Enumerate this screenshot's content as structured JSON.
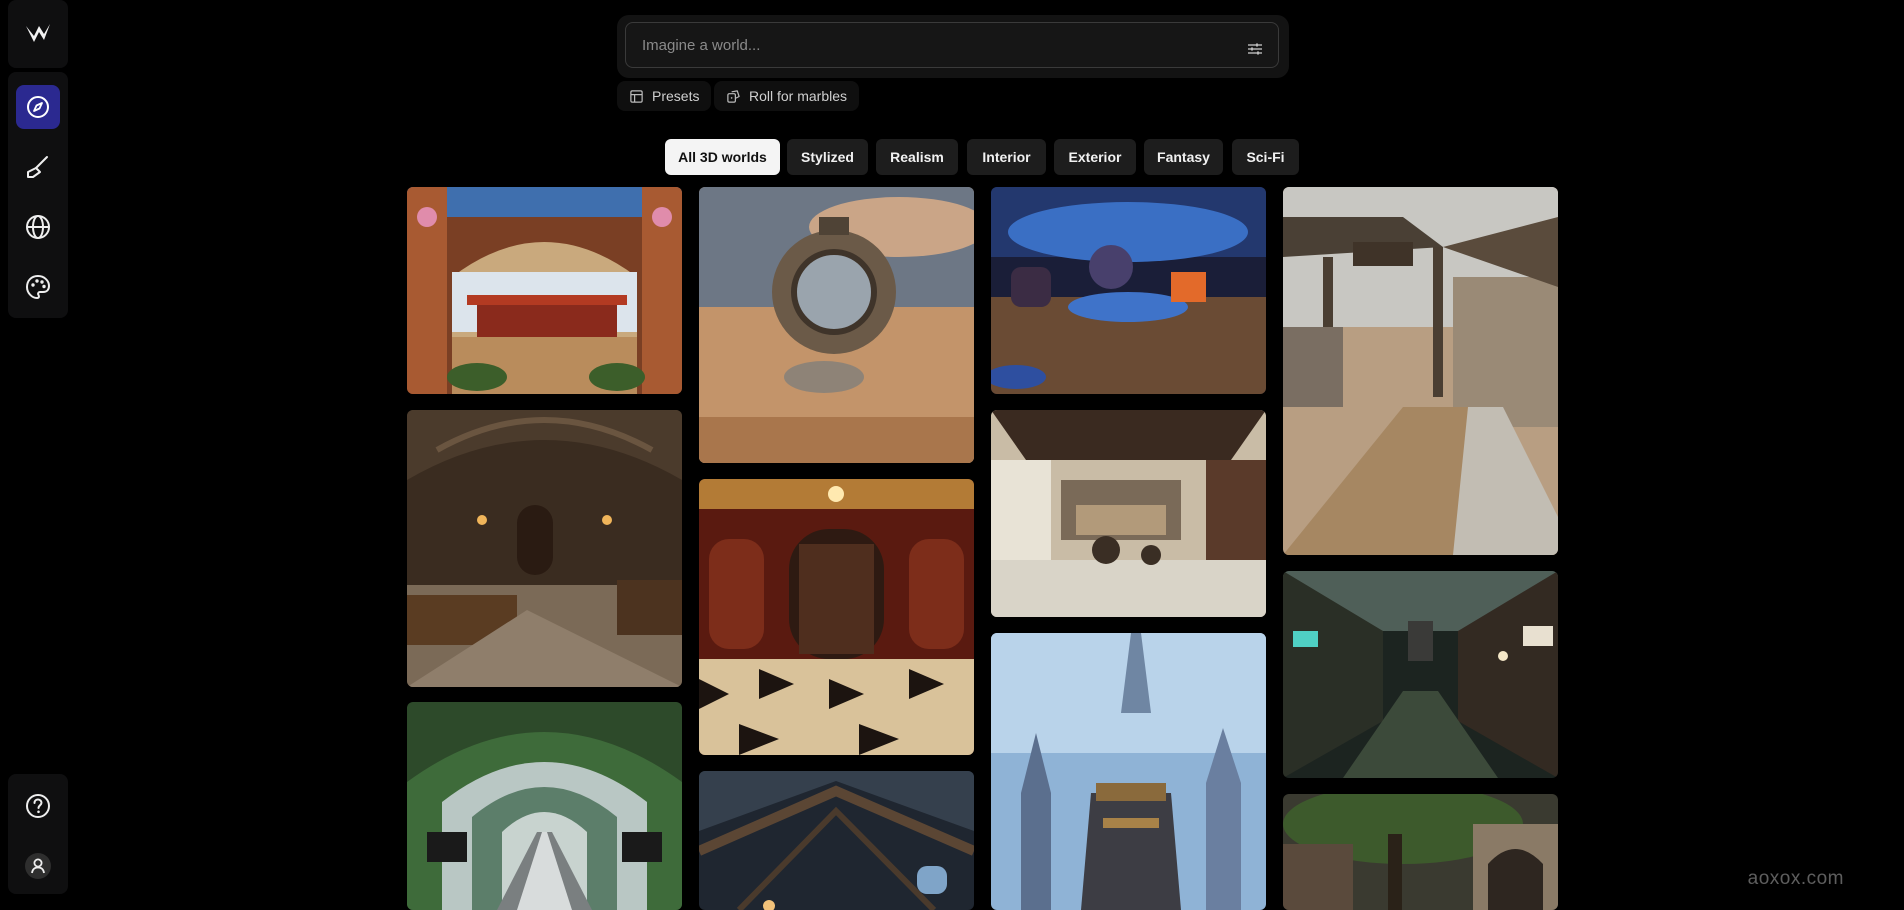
{
  "sidebar": {
    "logo_icon": "logo-icon",
    "nav": [
      {
        "name": "explore",
        "icon": "compass-icon",
        "active": true
      },
      {
        "name": "create",
        "icon": "brush-icon",
        "active": false
      },
      {
        "name": "worlds",
        "icon": "globe-icon",
        "active": false
      },
      {
        "name": "styles",
        "icon": "palette-icon",
        "active": false
      }
    ],
    "bottom": [
      {
        "name": "help",
        "icon": "help-icon"
      },
      {
        "name": "account",
        "icon": "user-icon"
      }
    ],
    "accent": "#2b2990"
  },
  "search": {
    "placeholder": "Imagine a world...",
    "value": ""
  },
  "actions": {
    "presets_label": "Presets",
    "roll_label": "Roll for marbles"
  },
  "tabs": [
    {
      "label": "All 3D worlds",
      "active": true
    },
    {
      "label": "Stylized",
      "active": false
    },
    {
      "label": "Realism",
      "active": false
    },
    {
      "label": "Interior",
      "active": false
    },
    {
      "label": "Exterior",
      "active": false
    },
    {
      "label": "Fantasy",
      "active": false
    },
    {
      "label": "Sci-Fi",
      "active": false
    }
  ],
  "gallery": {
    "tiles": [
      "ornate-arch-pagoda",
      "desert-ring-portal",
      "neon-sci-fi-arena",
      "gothic-stone-bedroom",
      "mahogany-doors-hall",
      "chinese-bedroom-interior",
      "village-gate-path",
      "green-tunnel-escalator",
      "wooden-attic-roof",
      "blue-fantasy-spires",
      "dark-asian-alley",
      "tree-courtyard"
    ]
  },
  "watermark": "aoxox.com"
}
